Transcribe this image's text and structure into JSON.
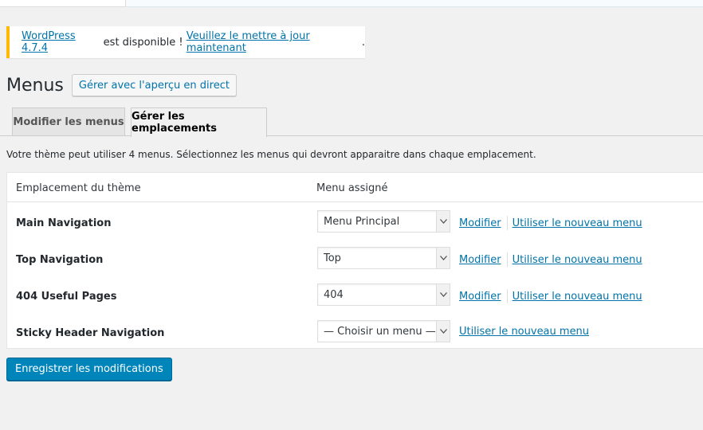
{
  "notice": {
    "version_link": "WordPress 4.7.4",
    "middle_text": " est disponible ! ",
    "update_link": "Veuillez le mettre à jour maintenant",
    "end_text": ".",
    "border_color": "#ffb900"
  },
  "header": {
    "title": "Menus",
    "live_preview_button": "Gérer avec l'aperçu en direct"
  },
  "tabs": [
    {
      "label": "Modifier les menus",
      "active": false
    },
    {
      "label": "Gérer les emplacements",
      "active": true
    }
  ],
  "description": "Votre thème peut utiliser 4 menus. Sélectionnez les menus qui devront apparaitre dans chaque emplacement.",
  "table": {
    "columns": [
      "Emplacement du thème",
      "Menu assigné"
    ],
    "rows": [
      {
        "location": "Main Navigation",
        "selected": "Menu Principal",
        "edit_link": "Modifier",
        "new_menu_link": "Utiliser le nouveau menu"
      },
      {
        "location": "Top Navigation",
        "selected": "Top",
        "edit_link": "Modifier",
        "new_menu_link": "Utiliser le nouveau menu"
      },
      {
        "location": "404 Useful Pages",
        "selected": "404",
        "edit_link": "Modifier",
        "new_menu_link": "Utiliser le nouveau menu"
      },
      {
        "location": "Sticky Header Navigation",
        "selected": "— Choisir un menu —",
        "new_menu_link": "Utiliser le nouveau menu"
      }
    ]
  },
  "save_button": "Enregistrer les modifications",
  "colors": {
    "link": "#0073aa",
    "primary_button": "#0085ba",
    "background": "#f1f1f1"
  },
  "icons": {
    "select_arrow": "chevron-down-icon"
  }
}
